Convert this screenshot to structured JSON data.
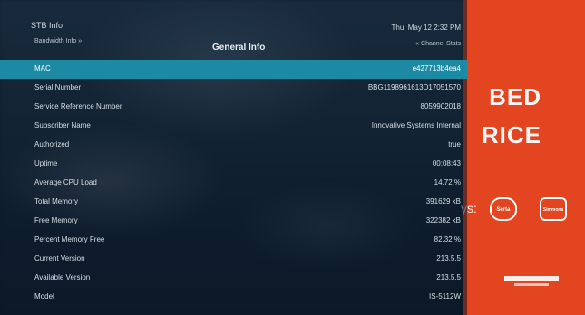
{
  "header": {
    "title": "STB Info",
    "subtitle": "Bandwidth Info »",
    "section": "General Info",
    "datetime": "Thu, May 12  2:32 PM",
    "channel": "« Channel Stats"
  },
  "rows": [
    {
      "label": "MAC",
      "value": "e427713b4ea4",
      "selected": true
    },
    {
      "label": "Serial Number",
      "value": "BBG1198961613D17051570",
      "selected": false
    },
    {
      "label": "Service Reference Number",
      "value": "8059902018",
      "selected": false
    },
    {
      "label": "Subscriber Name",
      "value": "Innovative Systems Internal",
      "selected": false
    },
    {
      "label": "Authorized",
      "value": "true",
      "selected": false
    },
    {
      "label": "Uptime",
      "value": "00:08:43",
      "selected": false
    },
    {
      "label": "Average CPU Load",
      "value": "14.72 %",
      "selected": false
    },
    {
      "label": "Total Memory",
      "value": "391629 kB",
      "selected": false
    },
    {
      "label": "Free Memory",
      "value": "322382 kB",
      "selected": false
    },
    {
      "label": "Percent Memory Free",
      "value": "82.32 %",
      "selected": false
    },
    {
      "label": "Current Version",
      "value": "213.5.5",
      "selected": false
    },
    {
      "label": "Available Version",
      "value": "213.5.5",
      "selected": false
    },
    {
      "label": "Model",
      "value": "IS-5112W",
      "selected": false
    }
  ],
  "ad": {
    "line1": "BED",
    "line2": "RICE",
    "partial": "ys:",
    "logo_a": "Serta",
    "logo_b": "Simmons",
    "accent": "#e2451f"
  },
  "colors": {
    "selected_row": "#1c8aa3",
    "text": "#d7dfe6"
  }
}
